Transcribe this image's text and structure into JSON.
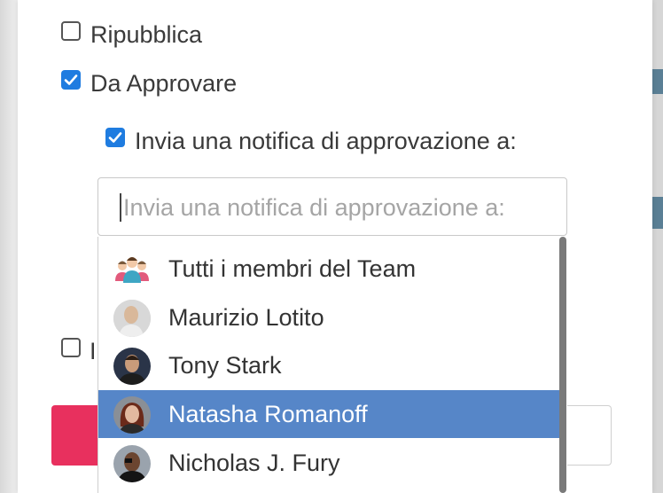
{
  "checkboxes": {
    "repubblica": {
      "label": "Ripubblica",
      "checked": false
    },
    "da_approvare": {
      "label": "Da Approvare",
      "checked": true
    },
    "invia_notifica": {
      "label": "Invia una notifica di approvazione a:",
      "checked": true
    },
    "partial": {
      "label": "I",
      "checked": false
    }
  },
  "recipient_input": {
    "placeholder": "Invia una notifica di approvazione a:",
    "value": ""
  },
  "dropdown": {
    "options": [
      {
        "name": "Tutti i membri del Team",
        "icon": "team-group-icon"
      },
      {
        "name": "Maurizio Lotito",
        "icon": "avatar"
      },
      {
        "name": "Tony Stark",
        "icon": "avatar"
      },
      {
        "name": "Natasha Romanoff",
        "icon": "avatar",
        "selected": true
      },
      {
        "name": "Nicholas J. Fury",
        "icon": "avatar"
      }
    ]
  },
  "colors": {
    "accent": "#1f7ce0",
    "selected_row": "#5686c8",
    "primary_button": "#e8305e"
  }
}
